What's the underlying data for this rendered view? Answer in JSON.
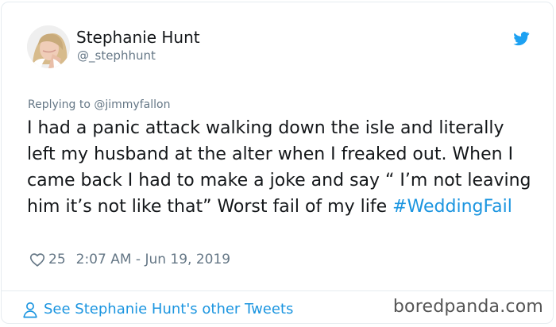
{
  "user": {
    "display_name": "Stephanie Hunt",
    "handle": "@_stephhunt"
  },
  "tweet": {
    "replying_to": "Replying to @jimmyfallon",
    "text": "I had a panic attack walking down the isle and literally left my husband at the alter when I freaked out. When I came back I had to make a joke and say “ I’m not leaving him it’s not like that” Worst fail of my life ",
    "hashtag": "#WeddingFail",
    "likes": "25",
    "timestamp": "2:07 AM - Jun 19, 2019"
  },
  "footer": {
    "profile_link": "See Stephanie Hunt's other Tweets",
    "watermark": "boredpanda.com"
  },
  "colors": {
    "link_blue": "#1b95e0",
    "muted_gray": "#657786",
    "text_black": "#14171a",
    "border": "#e6ecf0"
  },
  "icons": {
    "brand": "twitter-bird-icon",
    "like": "heart-icon",
    "profile": "person-icon"
  }
}
